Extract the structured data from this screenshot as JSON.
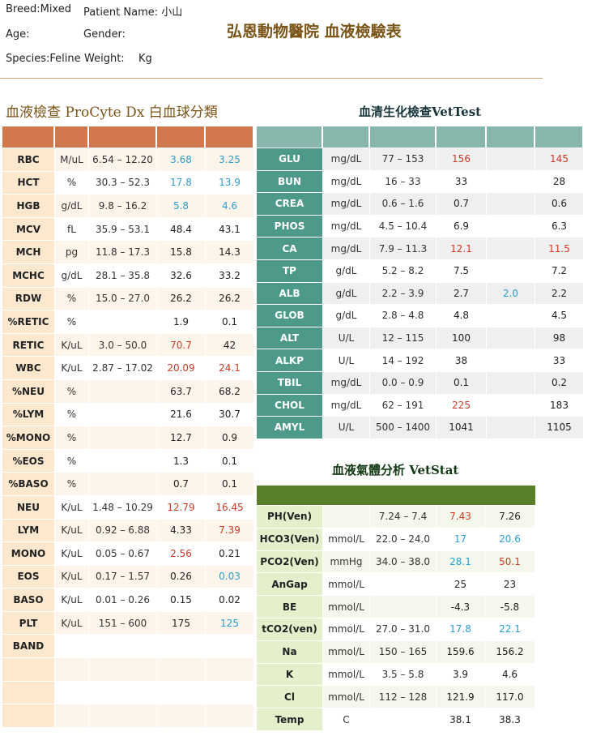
{
  "patient": {
    "breed": "Breed:Mixed",
    "patient_name": "Patient Name: 小山",
    "age": "Age:",
    "gender": "Gender:",
    "species": "Species:Feline",
    "weight": "Weight:",
    "weight_unit": "Kg"
  },
  "hospital_title": "弘恩動物醫院 血液檢驗表",
  "cbc": {
    "title": "血液檢查 ProCyte Dx 白血球分類",
    "colors": {
      "header": "#d0784c",
      "name_bg": "#fbe8cf"
    },
    "rows": [
      {
        "name": "RBC",
        "unit": "M/uL",
        "ref": "6.54 – 12.20",
        "v1": "3.68",
        "s1": "low",
        "v2": "3.25",
        "s2": "low"
      },
      {
        "name": "HCT",
        "unit": "%",
        "ref": "30.3 – 52.3",
        "v1": "17.8",
        "s1": "low",
        "v2": "13.9",
        "s2": "low"
      },
      {
        "name": "HGB",
        "unit": "g/dL",
        "ref": "9.8 – 16.2",
        "v1": "5.8",
        "s1": "low",
        "v2": "4.6",
        "s2": "low"
      },
      {
        "name": "MCV",
        "unit": "fL",
        "ref": "35.9 – 53.1",
        "v1": "48.4",
        "s1": "normal",
        "v2": "43.1",
        "s2": "normal"
      },
      {
        "name": "MCH",
        "unit": "pg",
        "ref": "11.8 – 17.3",
        "v1": "15.8",
        "s1": "normal",
        "v2": "14.3",
        "s2": "normal"
      },
      {
        "name": "MCHC",
        "unit": "g/dL",
        "ref": "28.1 – 35.8",
        "v1": "32.6",
        "s1": "normal",
        "v2": "33.2",
        "s2": "normal"
      },
      {
        "name": "RDW",
        "unit": "%",
        "ref": "15.0 – 27.0",
        "v1": "26.2",
        "s1": "normal",
        "v2": "26.2",
        "s2": "normal"
      },
      {
        "name": "%RETIC",
        "unit": "%",
        "ref": "",
        "v1": "1.9",
        "s1": "normal",
        "v2": "0.1",
        "s2": "normal"
      },
      {
        "name": "RETIC",
        "unit": "K/uL",
        "ref": "3.0 – 50.0",
        "v1": "70.7",
        "s1": "high",
        "v2": "42",
        "s2": "normal"
      },
      {
        "name": "WBC",
        "unit": "K/uL",
        "ref": "2.87 – 17.02",
        "v1": "20.09",
        "s1": "high",
        "v2": "24.1",
        "s2": "high"
      },
      {
        "name": "%NEU",
        "unit": "%",
        "ref": "",
        "v1": "63.7",
        "s1": "normal",
        "v2": "68.2",
        "s2": "normal"
      },
      {
        "name": "%LYM",
        "unit": "%",
        "ref": "",
        "v1": "21.6",
        "s1": "normal",
        "v2": "30.7",
        "s2": "normal"
      },
      {
        "name": "%MONO",
        "unit": "%",
        "ref": "",
        "v1": "12.7",
        "s1": "normal",
        "v2": "0.9",
        "s2": "normal"
      },
      {
        "name": "%EOS",
        "unit": "%",
        "ref": "",
        "v1": "1.3",
        "s1": "normal",
        "v2": "0.1",
        "s2": "normal"
      },
      {
        "name": "%BASO",
        "unit": "%",
        "ref": "",
        "v1": "0.7",
        "s1": "normal",
        "v2": "0.1",
        "s2": "normal"
      },
      {
        "name": "NEU",
        "unit": "K/uL",
        "ref": "1.48 – 10.29",
        "v1": "12.79",
        "s1": "high",
        "v2": "16.45",
        "s2": "high"
      },
      {
        "name": "LYM",
        "unit": "K/uL",
        "ref": "0.92 – 6.88",
        "v1": "4.33",
        "s1": "normal",
        "v2": "7.39",
        "s2": "high"
      },
      {
        "name": "MONO",
        "unit": "K/uL",
        "ref": "0.05 – 0.67",
        "v1": "2.56",
        "s1": "high",
        "v2": "0.21",
        "s2": "normal"
      },
      {
        "name": "EOS",
        "unit": "K/uL",
        "ref": "0.17 – 1.57",
        "v1": "0.26",
        "s1": "normal",
        "v2": "0.03",
        "s2": "low"
      },
      {
        "name": "BASO",
        "unit": "K/uL",
        "ref": "0.01 – 0.26",
        "v1": "0.15",
        "s1": "normal",
        "v2": "0.02",
        "s2": "normal"
      },
      {
        "name": "PLT",
        "unit": "K/uL",
        "ref": "151 – 600",
        "v1": "175",
        "s1": "normal",
        "v2": "125",
        "s2": "low"
      },
      {
        "name": "BAND",
        "unit": "",
        "ref": "",
        "v1": "",
        "s1": "normal",
        "v2": "",
        "s2": "normal"
      },
      {
        "name": "",
        "unit": "",
        "ref": "",
        "v1": "",
        "s1": "normal",
        "v2": "",
        "s2": "normal"
      },
      {
        "name": "",
        "unit": "",
        "ref": "",
        "v1": "",
        "s1": "normal",
        "v2": "",
        "s2": "normal"
      },
      {
        "name": "",
        "unit": "",
        "ref": "",
        "v1": "",
        "s1": "normal",
        "v2": "",
        "s2": "normal"
      }
    ]
  },
  "vettest": {
    "title": "血清生化檢查VetTest",
    "colors": {
      "header": "#87b6ad",
      "name_bg": "#4e9a8a"
    },
    "rows": [
      {
        "name": "GLU",
        "unit": "mg/dL",
        "ref": "77 – 153",
        "v1": "156",
        "s1": "high",
        "v2": "",
        "s2": "normal",
        "v3": "145",
        "s3": "high"
      },
      {
        "name": "BUN",
        "unit": "mg/dL",
        "ref": "16 – 33",
        "v1": "33",
        "s1": "normal",
        "v2": "",
        "s2": "normal",
        "v3": "28",
        "s3": "normal"
      },
      {
        "name": "CREA",
        "unit": "mg/dL",
        "ref": "0.6 – 1.6",
        "v1": "0.7",
        "s1": "normal",
        "v2": "",
        "s2": "normal",
        "v3": "0.6",
        "s3": "normal"
      },
      {
        "name": "PHOS",
        "unit": "mg/dL",
        "ref": "4.5 – 10.4",
        "v1": "6.9",
        "s1": "normal",
        "v2": "",
        "s2": "normal",
        "v3": "6.3",
        "s3": "normal"
      },
      {
        "name": "CA",
        "unit": "mg/dL",
        "ref": "7.9 – 11.3",
        "v1": "12.1",
        "s1": "high",
        "v2": "",
        "s2": "normal",
        "v3": "11.5",
        "s3": "high"
      },
      {
        "name": "TP",
        "unit": "g/dL",
        "ref": "5.2 – 8.2",
        "v1": "7.5",
        "s1": "normal",
        "v2": "",
        "s2": "normal",
        "v3": "7.2",
        "s3": "normal"
      },
      {
        "name": "ALB",
        "unit": "g/dL",
        "ref": "2.2 – 3.9",
        "v1": "2.7",
        "s1": "normal",
        "v2": "2.0",
        "s2": "low",
        "v3": "2.2",
        "s3": "normal"
      },
      {
        "name": "GLOB",
        "unit": "g/dL",
        "ref": "2.8 – 4.8",
        "v1": "4.8",
        "s1": "normal",
        "v2": "",
        "s2": "normal",
        "v3": "4.5",
        "s3": "normal"
      },
      {
        "name": "ALT",
        "unit": "U/L",
        "ref": "12 – 115",
        "v1": "100",
        "s1": "normal",
        "v2": "",
        "s2": "normal",
        "v3": "98",
        "s3": "normal"
      },
      {
        "name": "ALKP",
        "unit": "U/L",
        "ref": "14 – 192",
        "v1": "38",
        "s1": "normal",
        "v2": "",
        "s2": "normal",
        "v3": "33",
        "s3": "normal"
      },
      {
        "name": "TBIL",
        "unit": "mg/dL",
        "ref": "0.0 – 0.9",
        "v1": "0.1",
        "s1": "normal",
        "v2": "",
        "s2": "normal",
        "v3": "0.2",
        "s3": "normal"
      },
      {
        "name": "CHOL",
        "unit": "mg/dL",
        "ref": "62 – 191",
        "v1": "225",
        "s1": "high",
        "v2": "",
        "s2": "normal",
        "v3": "183",
        "s3": "normal"
      },
      {
        "name": "AMYL",
        "unit": "U/L",
        "ref": "500 – 1400",
        "v1": "1041",
        "s1": "normal",
        "v2": "",
        "s2": "normal",
        "v3": "1105",
        "s3": "normal"
      }
    ]
  },
  "vetstat": {
    "title": "血液氣體分析 VetStat",
    "colors": {
      "header": "#5a7f2b",
      "name_bg": "#e4efcc"
    },
    "rows": [
      {
        "name": "PH(Ven)",
        "unit": "",
        "ref": "7.24 – 7.4",
        "v1": "7.43",
        "s1": "high",
        "v2": "7.26",
        "s2": "normal"
      },
      {
        "name": "HCO3(Ven)",
        "unit": "mmol/L",
        "ref": "22.0 – 24.0",
        "v1": "17",
        "s1": "low",
        "v2": "20.6",
        "s2": "low"
      },
      {
        "name": "PCO2(Ven)",
        "unit": "mmHg",
        "ref": "34.0 – 38.0",
        "v1": "28.1",
        "s1": "low",
        "v2": "50.1",
        "s2": "high"
      },
      {
        "name": "AnGap",
        "unit": "mmol/L",
        "ref": "",
        "v1": "25",
        "s1": "normal",
        "v2": "23",
        "s2": "normal"
      },
      {
        "name": "BE",
        "unit": "mmol/L",
        "ref": "",
        "v1": "-4.3",
        "s1": "normal",
        "v2": "-5.8",
        "s2": "normal"
      },
      {
        "name": "tCO2(ven)",
        "unit": "mmol/L",
        "ref": "27.0 – 31.0",
        "v1": "17.8",
        "s1": "low",
        "v2": "22.1",
        "s2": "low"
      },
      {
        "name": "Na",
        "unit": "mmol/L",
        "ref": "150 – 165",
        "v1": "159.6",
        "s1": "normal",
        "v2": "156.2",
        "s2": "normal"
      },
      {
        "name": "K",
        "unit": "mmol/L",
        "ref": "3.5 – 5.8",
        "v1": "3.9",
        "s1": "normal",
        "v2": "4.6",
        "s2": "normal"
      },
      {
        "name": "Cl",
        "unit": "mmol/L",
        "ref": "112 – 128",
        "v1": "121.9",
        "s1": "normal",
        "v2": "117.0",
        "s2": "normal"
      },
      {
        "name": "Temp",
        "unit": "C",
        "ref": "",
        "v1": "38.1",
        "s1": "normal",
        "v2": "38.3",
        "s2": "normal"
      }
    ]
  },
  "status_colors": {
    "normal": "#222222",
    "high": "#d03a25",
    "low": "#2a9fd0"
  }
}
